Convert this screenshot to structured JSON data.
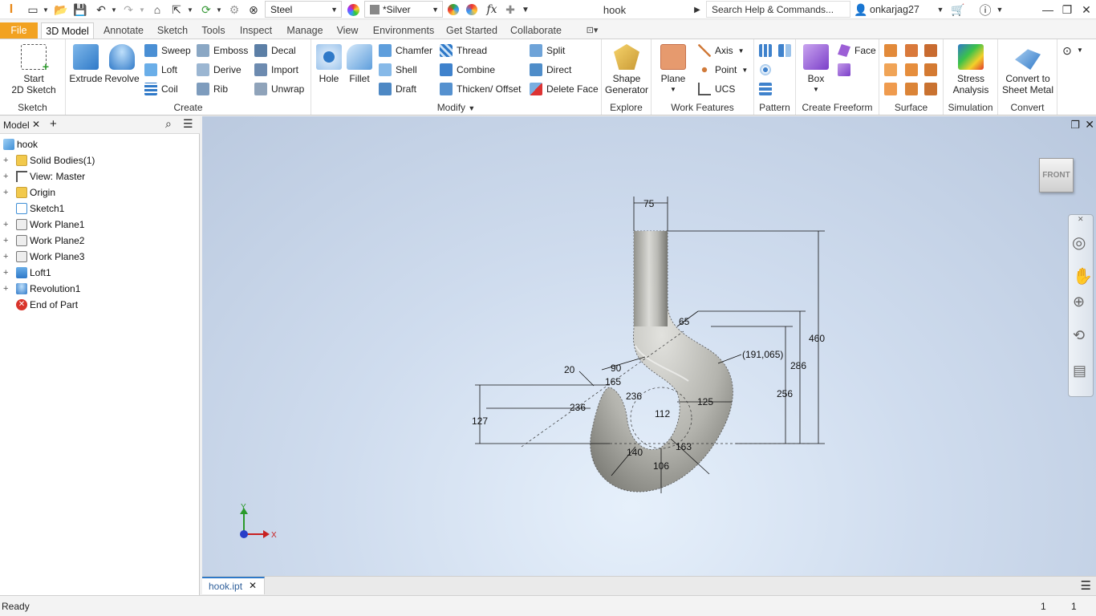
{
  "app": {
    "logo": "I",
    "document_title": "hook"
  },
  "quick_access": {
    "material": "Steel",
    "appearance": "*Silver",
    "fx_label": "fx",
    "search_placeholder": "Search Help & Commands...",
    "user": "onkarjag27"
  },
  "tabs": [
    "File",
    "3D Model",
    "Annotate",
    "Sketch",
    "Tools",
    "Inspect",
    "Manage",
    "View",
    "Environments",
    "Get Started",
    "Collaborate"
  ],
  "active_tab": "3D Model",
  "ribbon": {
    "sketch": {
      "label": "Sketch",
      "start_line1": "Start",
      "start_line2": "2D Sketch"
    },
    "create": {
      "label": "Create",
      "extrude": "Extrude",
      "revolve": "Revolve",
      "sweep": "Sweep",
      "loft": "Loft",
      "coil": "Coil",
      "emboss": "Emboss",
      "derive": "Derive",
      "rib": "Rib",
      "decal": "Decal",
      "import": "Import",
      "unwrap": "Unwrap"
    },
    "modify": {
      "label": "Modify",
      "hole": "Hole",
      "fillet": "Fillet",
      "chamfer": "Chamfer",
      "shell": "Shell",
      "draft": "Draft",
      "thread": "Thread",
      "combine": "Combine",
      "thicken": "Thicken/ Offset",
      "split": "Split",
      "direct": "Direct",
      "delete_face": "Delete Face"
    },
    "explore": {
      "label": "Explore",
      "shape_gen_line1": "Shape",
      "shape_gen_line2": "Generator"
    },
    "work_features": {
      "label": "Work Features",
      "plane": "Plane",
      "axis": "Axis",
      "point": "Point",
      "ucs": "UCS"
    },
    "pattern": {
      "label": "Pattern"
    },
    "freeform": {
      "label": "Create Freeform",
      "box": "Box",
      "face": "Face"
    },
    "surface": {
      "label": "Surface"
    },
    "simulation": {
      "label": "Simulation",
      "stress_line1": "Stress",
      "stress_line2": "Analysis"
    },
    "convert": {
      "label": "Convert",
      "line1": "Convert to",
      "line2": "Sheet Metal"
    }
  },
  "browser": {
    "tab_label": "Model",
    "items": [
      {
        "label": "hook",
        "icon": "part-icon"
      },
      {
        "label": "Solid Bodies(1)",
        "icon": "folder-icon"
      },
      {
        "label": "View: Master",
        "icon": "view-icon"
      },
      {
        "label": "Origin",
        "icon": "folder-icon"
      },
      {
        "label": "Sketch1",
        "icon": "sketch-icon"
      },
      {
        "label": "Work Plane1",
        "icon": "workplane-icon"
      },
      {
        "label": "Work Plane2",
        "icon": "workplane-icon"
      },
      {
        "label": "Work Plane3",
        "icon": "workplane-icon"
      },
      {
        "label": "Loft1",
        "icon": "loft-icon"
      },
      {
        "label": "Revolution1",
        "icon": "revolve-icon"
      },
      {
        "label": "End of Part",
        "icon": "end-of-part-icon"
      }
    ]
  },
  "viewcube": {
    "face": "FRONT"
  },
  "dimensions": {
    "d75": "75",
    "d460": "460",
    "d65": "65",
    "d191": "(191,065)",
    "d286": "286",
    "d256": "256",
    "d20": "20",
    "d90": "90",
    "d165": "165",
    "d236a": "236",
    "d127": "127",
    "d236b": "236",
    "d125": "125",
    "d112": "112",
    "d163": "163",
    "d140": "140",
    "d106": "106"
  },
  "triad": {
    "x": "X",
    "y": "Y"
  },
  "document_tab": "hook.ipt",
  "status": {
    "text": "Ready",
    "count1": "1",
    "count2": "1"
  },
  "colors": {
    "file_tab": "#f2a221",
    "ribbon_bg": "#ffffff",
    "accent_blue": "#2f79c8"
  }
}
